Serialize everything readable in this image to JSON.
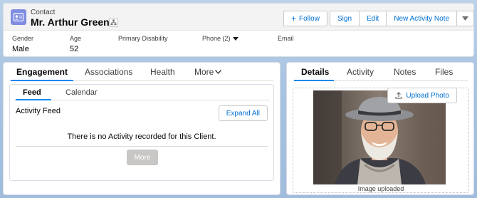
{
  "header": {
    "record_type": "Contact",
    "record_name": "Mr. Arthur Green",
    "icons": {
      "record": "contact-card-icon",
      "hierarchy": "hierarchy-icon"
    },
    "actions": {
      "follow": "Follow",
      "sign": "Sign",
      "edit": "Edit",
      "new_activity_note": "New Activity Note"
    },
    "fields": [
      {
        "label": "Gender",
        "value": "Male"
      },
      {
        "label": "Age",
        "value": "52"
      },
      {
        "label": "Primary Disability",
        "value": ""
      },
      {
        "label": "Phone (2)",
        "value": ""
      },
      {
        "label": "Email",
        "value": ""
      }
    ]
  },
  "left_panel": {
    "tabs": [
      "Engagement",
      "Associations",
      "Health",
      "More"
    ],
    "active_tab": "Engagement",
    "subtabs": [
      "Feed",
      "Calendar"
    ],
    "active_subtab": "Feed",
    "activity_feed_title": "Activity Feed",
    "expand_all": "Expand All",
    "empty_message": "There is no Activity recorded for this Client.",
    "more_button": "More"
  },
  "right_panel": {
    "tabs": [
      "Details",
      "Activity",
      "Notes",
      "Files"
    ],
    "active_tab": "Details",
    "upload_photo": "Upload Photo",
    "caption": "Image uploaded"
  },
  "colors": {
    "brand_blue": "#0070d2",
    "tab_underline": "#1589ee",
    "record_icon": "#7f8de1",
    "background": "#a9c4e2"
  }
}
